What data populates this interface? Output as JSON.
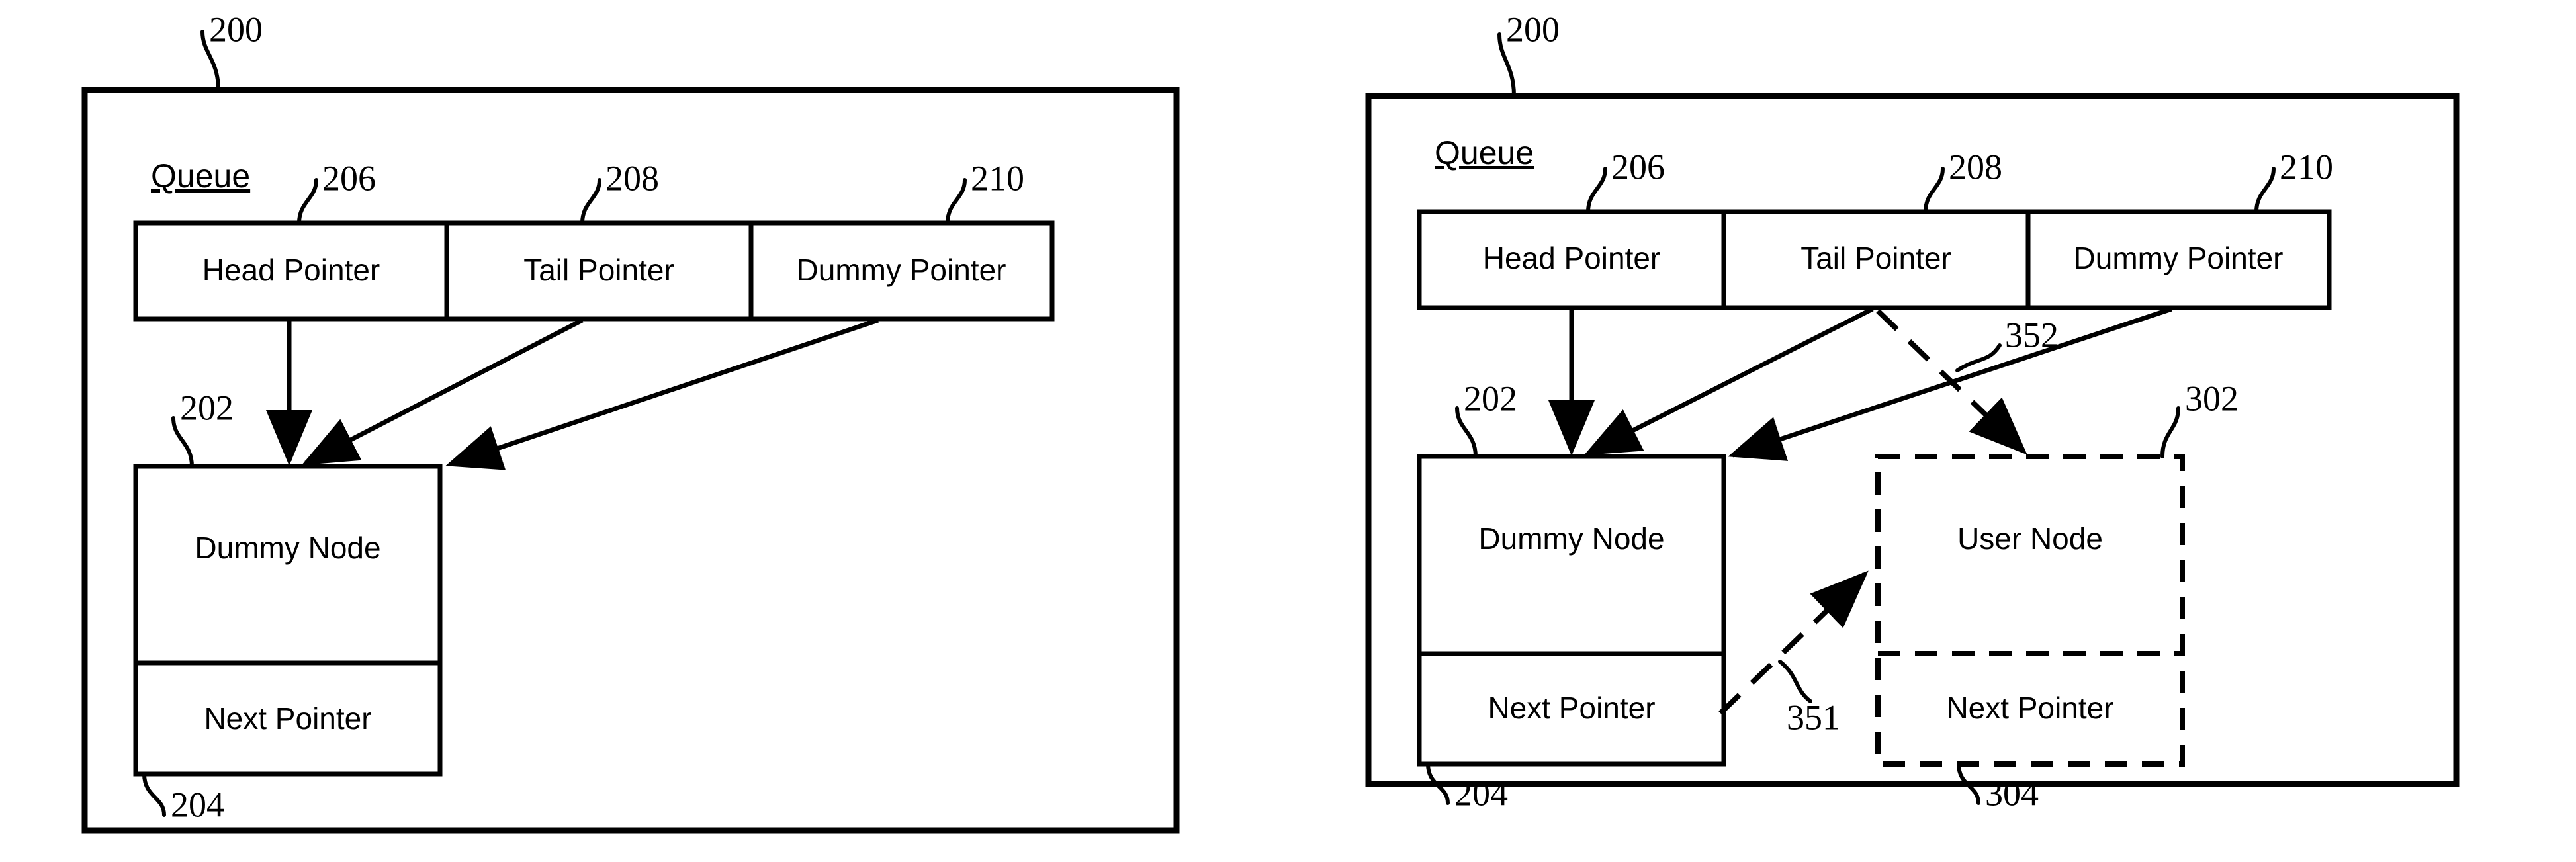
{
  "figure": {
    "type": "patent-diagram",
    "description": "Queue data structure diagram, two states: empty queue with dummy node, and queue after user node enqueued",
    "colors": {
      "line": "#000000",
      "background": "#ffffff"
    }
  },
  "panels": [
    {
      "id": "left",
      "outer_ref": "200",
      "title": "Queue",
      "pointer_row": [
        {
          "label": "Head Pointer",
          "ref": "206"
        },
        {
          "label": "Tail Pointer",
          "ref": "208"
        },
        {
          "label": "Dummy Pointer",
          "ref": "210"
        }
      ],
      "nodes": [
        {
          "name": "dummy-node",
          "ref": "202",
          "style": "solid",
          "sections": [
            {
              "label": "Dummy Node",
              "ref": "202"
            },
            {
              "label": "Next Pointer",
              "ref": "204"
            }
          ]
        }
      ],
      "arrows": [
        {
          "from": "Head Pointer",
          "to": "Dummy Node",
          "style": "solid"
        },
        {
          "from": "Tail Pointer",
          "to": "Dummy Node",
          "style": "solid"
        },
        {
          "from": "Dummy Pointer",
          "to": "Dummy Node",
          "style": "solid"
        }
      ]
    },
    {
      "id": "right",
      "outer_ref": "200",
      "title": "Queue",
      "pointer_row": [
        {
          "label": "Head Pointer",
          "ref": "206"
        },
        {
          "label": "Tail Pointer",
          "ref": "208"
        },
        {
          "label": "Dummy Pointer",
          "ref": "210"
        }
      ],
      "nodes": [
        {
          "name": "dummy-node",
          "ref": "202",
          "style": "solid",
          "sections": [
            {
              "label": "Dummy Node",
              "ref": "202"
            },
            {
              "label": "Next Pointer",
              "ref": "204"
            }
          ]
        },
        {
          "name": "user-node",
          "ref": "302",
          "style": "dashed",
          "sections": [
            {
              "label": "User Node",
              "ref": "302"
            },
            {
              "label": "Next Pointer",
              "ref": "304"
            }
          ]
        }
      ],
      "arrows": [
        {
          "from": "Head Pointer",
          "to": "Dummy Node",
          "style": "solid"
        },
        {
          "from": "Tail Pointer",
          "to": "Dummy Node",
          "style": "solid"
        },
        {
          "from": "Dummy Pointer",
          "to": "Dummy Node",
          "style": "solid"
        },
        {
          "from": "Tail Pointer",
          "to": "User Node",
          "style": "dashed",
          "ref": "352"
        },
        {
          "from": "Dummy Node Next Pointer",
          "to": "User Node",
          "style": "dashed",
          "ref": "351"
        }
      ]
    }
  ],
  "labels": {
    "left": {
      "ref_200": "200",
      "title": "Queue",
      "ref_206": "206",
      "ref_208": "208",
      "ref_210": "210",
      "head_pointer": "Head Pointer",
      "tail_pointer": "Tail Pointer",
      "dummy_pointer": "Dummy Pointer",
      "ref_202": "202",
      "dummy_node": "Dummy Node",
      "next_pointer": "Next Pointer",
      "ref_204": "204"
    },
    "right": {
      "ref_200": "200",
      "title": "Queue",
      "ref_206": "206",
      "ref_208": "208",
      "ref_210": "210",
      "head_pointer": "Head Pointer",
      "tail_pointer": "Tail Pointer",
      "dummy_pointer": "Dummy Pointer",
      "ref_202": "202",
      "dummy_node": "Dummy Node",
      "next_pointer": "Next Pointer",
      "ref_204": "204",
      "ref_302": "302",
      "user_node": "User Node",
      "user_next_pointer": "Next Pointer",
      "ref_304": "304",
      "ref_351": "351",
      "ref_352": "352"
    }
  }
}
